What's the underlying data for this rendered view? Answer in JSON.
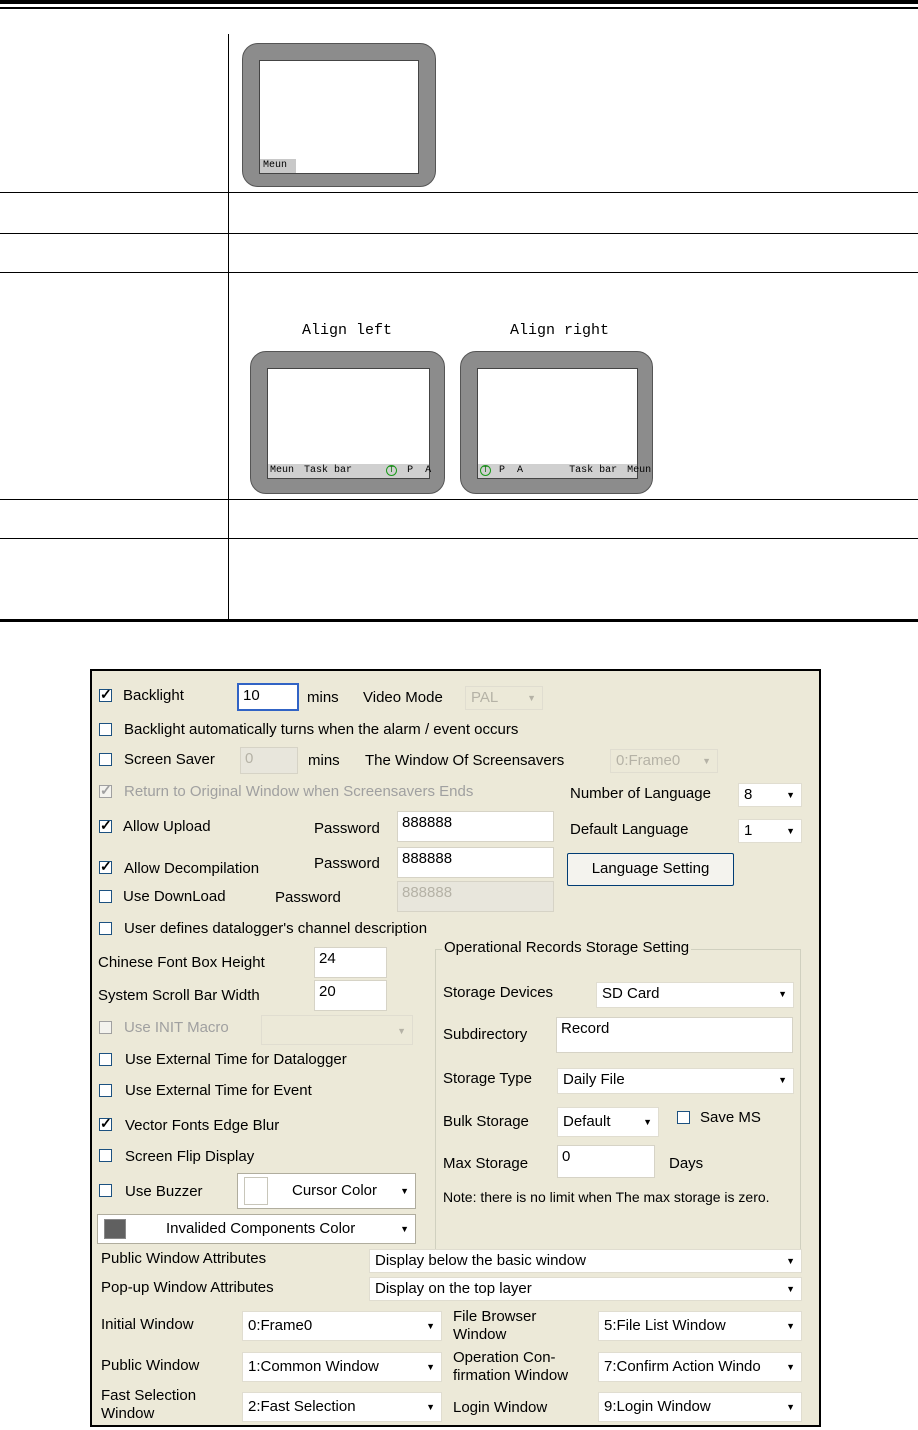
{
  "doc": {
    "menu_preview_label": "Meun",
    "align_left_title": "Align left",
    "align_right_title": "Align right",
    "left_bar_menu": "Meun",
    "left_bar_taskbar": "Task bar",
    "right_bar_taskbar": "Task bar",
    "right_bar_menu": "Meun",
    "indicator_t": "T",
    "indicator_p": "P",
    "indicator_a": "A"
  },
  "dialog": {
    "backlight_label": "Backlight",
    "backlight_checked": true,
    "backlight_value": "10",
    "mins_label": "mins",
    "video_mode_label": "Video Mode",
    "video_mode_value": "PAL",
    "backlight_alarm_label": "Backlight automatically turns when the alarm / event occurs",
    "screen_saver_label": "Screen Saver",
    "screen_saver_value": "0",
    "screen_saver_mins": "mins",
    "window_of_screensavers_label": "The Window Of Screensavers",
    "window_of_screensavers_value": "0:Frame0",
    "return_original_label": "Return to Original Window when Screensavers Ends",
    "number_of_language_label": "Number of Language",
    "number_of_language_value": "8",
    "allow_upload_label": "Allow Upload",
    "upload_password_label": "Password",
    "upload_password_value": "888888",
    "default_language_label": "Default Language",
    "default_language_value": "1",
    "allow_decompilation_label": "Allow Decompilation",
    "decompilation_password_label": "Password",
    "decompilation_password_value": "888888",
    "language_setting_button": "Language Setting",
    "use_download_label": "Use DownLoad",
    "download_password_label": "Password",
    "download_password_value": "888888",
    "user_defines_label": "User defines datalogger's channel description",
    "chinese_font_label": "Chinese Font Box Height",
    "chinese_font_value": "24",
    "scroll_bar_label": "System Scroll Bar Width",
    "scroll_bar_value": "20",
    "init_macro_label": "Use INIT Macro",
    "external_time_datalogger_label": "Use External Time for Datalogger",
    "external_time_event_label": "Use External Time for Event",
    "vector_fonts_label": "Vector Fonts Edge Blur",
    "screen_flip_label": "Screen Flip Display",
    "use_buzzer_label": "Use Buzzer",
    "cursor_color_label": "Cursor Color",
    "invalided_color_label": "Invalided Components Color",
    "storage_group_title": "Operational Records Storage Setting",
    "storage_devices_label": "Storage Devices",
    "storage_devices_value": "SD Card",
    "subdirectory_label": "Subdirectory",
    "subdirectory_value": "Record",
    "storage_type_label": "Storage Type",
    "storage_type_value": "Daily File",
    "bulk_storage_label": "Bulk Storage",
    "bulk_storage_value": "Default",
    "save_ms_label": "Save MS",
    "max_storage_label": "Max Storage",
    "max_storage_value": "0",
    "days_label": "Days",
    "storage_note": "Note: there is no limit when The max storage is zero.",
    "public_window_attr_label": "Public Window Attributes",
    "public_window_attr_value": "Display below the basic window",
    "popup_window_attr_label": "Pop-up Window Attributes",
    "popup_window_attr_value": "Display on the top layer",
    "initial_window_label": "Initial Window",
    "initial_window_value": "0:Frame0",
    "file_browser_label_1": "File Browser",
    "file_browser_label_2": "Window",
    "file_browser_value": "5:File List Window",
    "public_window_label": "Public Window",
    "public_window_value": "1:Common Window",
    "operation_confirm_label_1": "Operation Con-",
    "operation_confirm_label_2": "firmation Window",
    "operation_confirm_value": "7:Confirm Action Windo",
    "fast_selection_label_1": "Fast Selection",
    "fast_selection_label_2": "Window",
    "fast_selection_value": "2:Fast Selection",
    "login_window_label": "Login Window",
    "login_window_value": "9:Login Window"
  },
  "colors": {
    "dialog_bg": "#ece9d8",
    "cursor_color": "#ffffff",
    "invalided_components_color": "#606060",
    "focus_border": "#3163c5",
    "disabled_text": "#a0a0a0"
  }
}
